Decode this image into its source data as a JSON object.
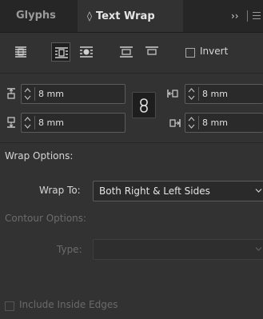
{
  "tabs": {
    "glyphs": "Glyphs",
    "text_wrap": "Text Wrap",
    "text_wrap_glyph": "◊",
    "overflow": "››"
  },
  "wrap_modes": [
    {
      "icon": "no-text-wrap-icon",
      "selected": false
    },
    {
      "icon": "wrap-around-bounding-box-icon",
      "selected": true
    },
    {
      "icon": "wrap-around-object-shape-icon",
      "selected": false
    },
    {
      "icon": "jump-object-icon",
      "selected": false
    },
    {
      "icon": "jump-to-next-column-icon",
      "selected": false
    }
  ],
  "invert": {
    "label": "Invert",
    "checked": false
  },
  "offsets": {
    "top": "8 mm",
    "bottom": "8 mm",
    "left": "8 mm",
    "right": "8 mm",
    "linked": true
  },
  "wrap_options": {
    "heading": "Wrap Options:",
    "wrap_to_label": "Wrap To:",
    "wrap_to_value": "Both Right & Left Sides"
  },
  "contour_options": {
    "heading": "Contour Options:",
    "type_label": "Type:",
    "type_value": ""
  },
  "include_inside_edges": {
    "label": "Include Inside Edges",
    "checked": false
  },
  "colors": {
    "panel": "#323232",
    "tabbar": "#262626",
    "field": "#2a2a2a",
    "text": "#d6d6d6",
    "disabled_text": "#6c6c6c"
  }
}
